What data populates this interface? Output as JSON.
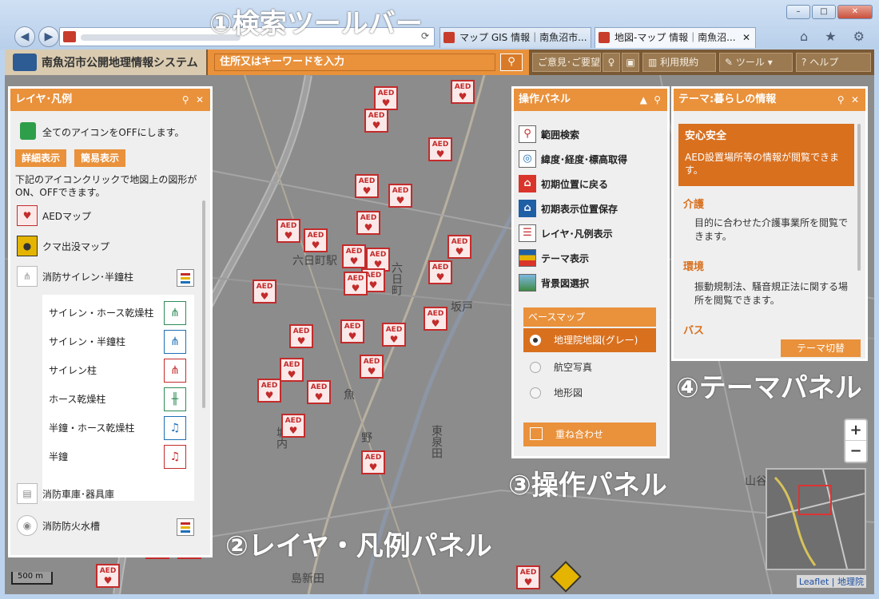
{
  "browser": {
    "tabs": [
      {
        "label": "マップ GIS 情報｜南魚沼市..."
      },
      {
        "label": "地図-マップ 情報｜南魚沼..."
      }
    ],
    "window_controls": {
      "minimize": "–",
      "maximize": "□",
      "close": "✕"
    },
    "chrome_icons": "⌂ ★ ⚙"
  },
  "app": {
    "title": "南魚沼市公開地理情報システム",
    "search_placeholder": "住所又はキーワードを入力",
    "header_buttons": {
      "feedback": "ご意見･ご要望",
      "terms": "利用規約",
      "tools": "ツール",
      "help": "ヘルプ"
    }
  },
  "layer_panel": {
    "title": "レイヤ･凡例",
    "all_off_text": "全てのアイコンをOFFにします。",
    "tabs": [
      "詳細表示",
      "簡易表示"
    ],
    "note": "下記のアイコンクリックで地図上の図形がON、OFFできます。",
    "items": [
      {
        "label": "AEDマップ",
        "icon": "aed-icon"
      },
      {
        "label": "クマ出没マップ",
        "icon": "bear-icon"
      },
      {
        "label": "消防サイレン･半鐘柱",
        "icon": "siren-icon"
      },
      {
        "label": "消防車庫･器具庫",
        "icon": "garage-icon"
      },
      {
        "label": "消防防火水槽",
        "icon": "water-tank-icon"
      }
    ],
    "subitems": [
      {
        "label": "サイレン・ホース乾燥柱",
        "color": "#2e8b57"
      },
      {
        "label": "サイレン・半鐘柱",
        "color": "#1f6fb5"
      },
      {
        "label": "サイレン柱",
        "color": "#c32b2b"
      },
      {
        "label": "ホース乾燥柱",
        "color": "#2e8b57"
      },
      {
        "label": "半鐘・ホース乾燥柱",
        "color": "#1f6fb5"
      },
      {
        "label": "半鐘",
        "color": "#c32b2b"
      }
    ]
  },
  "ops_panel": {
    "title": "操作パネル",
    "items": [
      {
        "label": "範囲検索",
        "icon": "range-search-icon"
      },
      {
        "label": "緯度･経度･標高取得",
        "icon": "coordinate-icon"
      },
      {
        "label": "初期位置に戻る",
        "icon": "home-red-icon"
      },
      {
        "label": "初期表示位置保存",
        "icon": "home-blue-icon"
      },
      {
        "label": "レイヤ･凡例表示",
        "icon": "legend-icon"
      },
      {
        "label": "テーマ表示",
        "icon": "theme-icon"
      },
      {
        "label": "背景図選択",
        "icon": "background-icon"
      }
    ],
    "basemap_header": "ベースマップ",
    "basemaps": [
      "地理院地図(グレー)",
      "航空写真",
      "地形図"
    ],
    "selected_basemap": 0,
    "overlay_label": "重ね合わせ"
  },
  "theme_panel": {
    "title": "テーマ:暮らしの情報",
    "selected": {
      "name": "安心安全",
      "desc": "AED設置場所等の情報が閲覧できます。"
    },
    "categories": [
      {
        "name": "介護",
        "desc": "目的に合わせた介護事業所を閲覧できます。"
      },
      {
        "name": "環境",
        "desc": "振動規制法、騒音規正法に関する場所を閲覧できます。"
      },
      {
        "name": "バス",
        "desc": ""
      }
    ],
    "switch_button": "テーマ切替"
  },
  "annotations": {
    "toolbar": "①検索ツールバー",
    "layer": "②レイヤ・凡例パネル",
    "ops": "③操作パネル",
    "theme": "④テーマパネル"
  },
  "map": {
    "labels": [
      "六日町駅",
      "六日町",
      "坂戸",
      "野",
      "東泉田",
      "魚",
      "島新田",
      "山谷",
      "城内"
    ],
    "aed_label": "AED",
    "zoom_in": "+",
    "zoom_out": "−",
    "scale": "500 m",
    "attribution": "Leaflet | 地理院"
  }
}
